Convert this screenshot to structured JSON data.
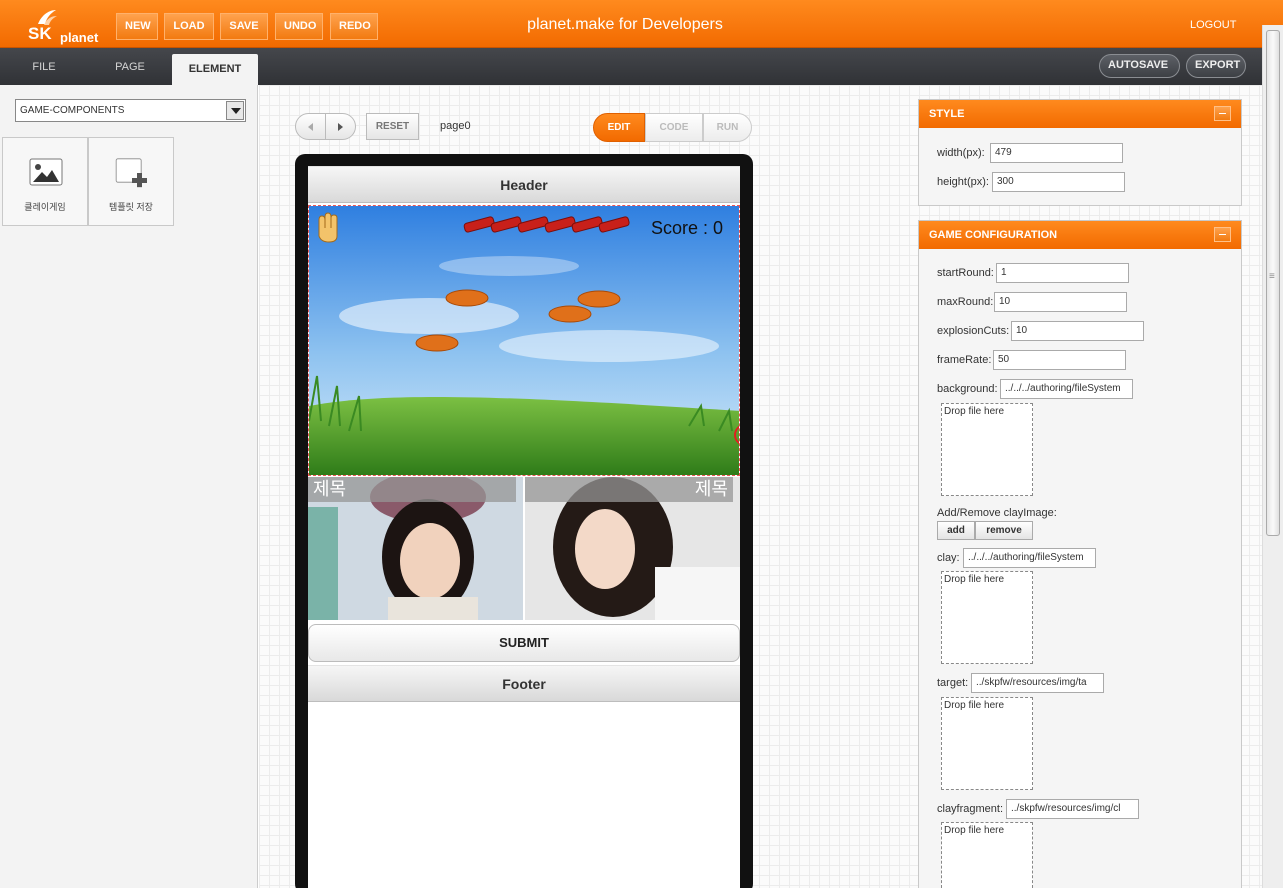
{
  "app": {
    "title": "planet.make for Developers",
    "logo": {
      "brand": "SK",
      "sub": "planet"
    },
    "toolbar": {
      "new": "NEW",
      "load": "LOAD",
      "save": "SAVE",
      "undo": "UNDO",
      "redo": "REDO"
    },
    "logout": "LOGOUT",
    "accent": "#f26a00"
  },
  "tabs": {
    "file": "FILE",
    "page": "PAGE",
    "element": "ELEMENT",
    "active": "ELEMENT"
  },
  "actions": {
    "autosave": "AUTOSAVE",
    "export": "EXPORT"
  },
  "sidebar": {
    "select_value": "GAME-COMPONENTS",
    "components": [
      {
        "label": "클레이게임",
        "icon": "image-icon"
      },
      {
        "label": "템플릿 저장",
        "icon": "add-template-icon"
      }
    ]
  },
  "canvas": {
    "reset": "RESET",
    "page_name": "page0",
    "modes": {
      "edit": "EDIT",
      "code": "CODE",
      "run": "RUN",
      "active": "EDIT"
    }
  },
  "phone": {
    "header": "Header",
    "score": "Score : 0",
    "shells": 6,
    "photo_captions": [
      "제목",
      "제목"
    ],
    "submit": "SUBMIT",
    "footer": "Footer"
  },
  "style_panel": {
    "title": "STYLE",
    "width_label": "width(px):",
    "width_value": "479",
    "height_label": "height(px):",
    "height_value": "300"
  },
  "game_panel": {
    "title": "GAME CONFIGURATION",
    "startRound_label": "startRound:",
    "startRound_value": "1",
    "maxRound_label": "maxRound:",
    "maxRound_value": "10",
    "explosionCuts_label": "explosionCuts:",
    "explosionCuts_value": "10",
    "frameRate_label": "frameRate:",
    "frameRate_value": "50",
    "background_label": "background:",
    "background_value": "../../../authoring/fileSystem",
    "drop_text": "Drop file here",
    "clay_add_remove_label": "Add/Remove clayImage:",
    "add_button": "add",
    "remove_button": "remove",
    "clay_label": "clay:",
    "clay_value": "../../../authoring/fileSystem",
    "target_label": "target:",
    "target_value": "../skpfw/resources/img/ta",
    "clayfragment_label": "clayfragment:",
    "clayfragment_value": "../skpfw/resources/img/cl"
  }
}
